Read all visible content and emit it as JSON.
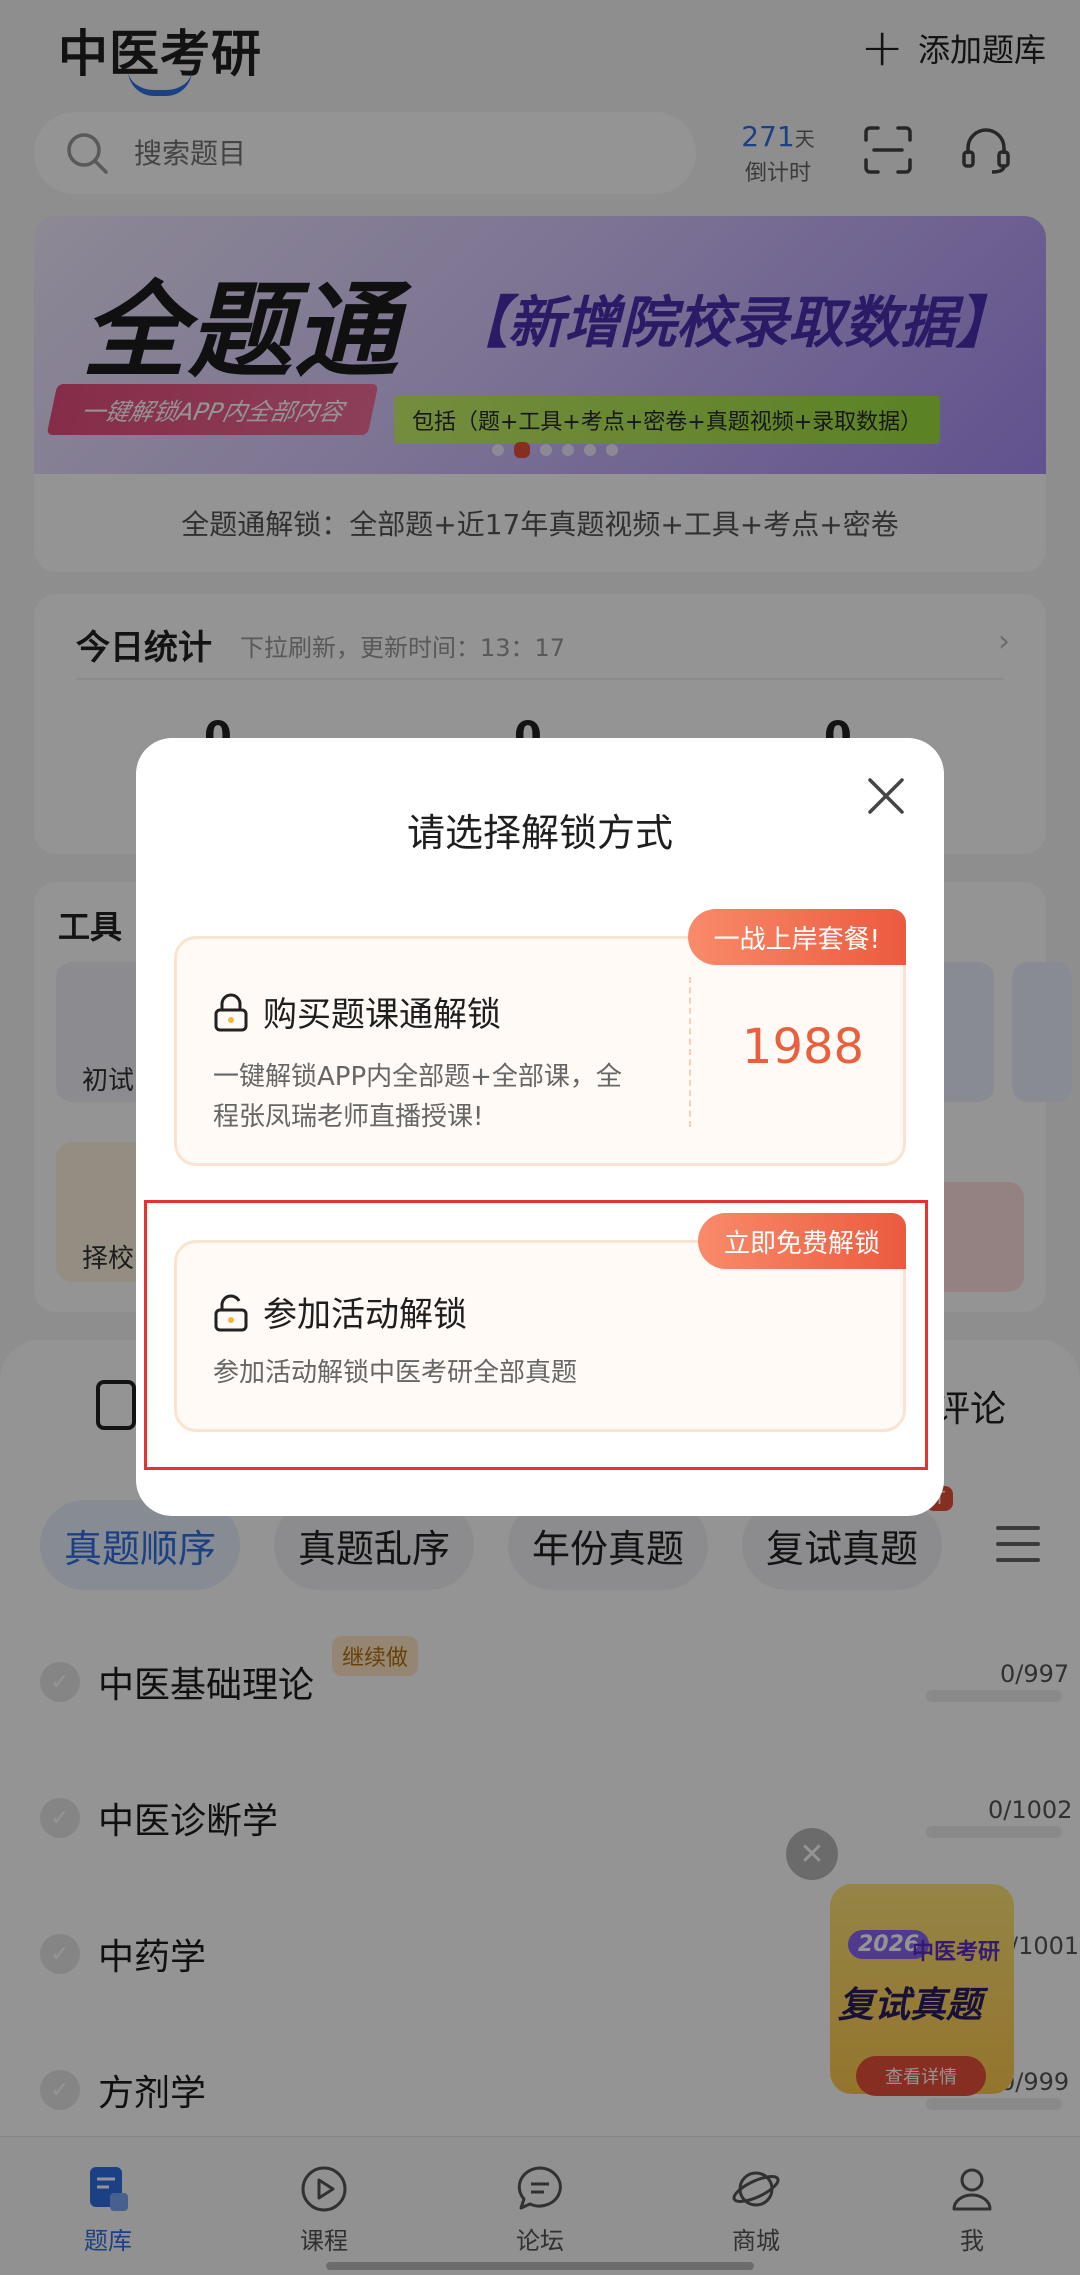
{
  "header": {
    "app_title": "中医考研",
    "add_bank_label": "添加题库",
    "search_placeholder": "搜索题目",
    "countdown_num": "271",
    "countdown_unit": "天",
    "countdown_label": "倒计时"
  },
  "banner": {
    "title": "全题通",
    "subtitle": "【新增院校录取数据】",
    "tag": "一键解锁APP内全部内容",
    "desc": "包括（题+工具+考点+密卷+真题视频+录取数据）",
    "unlock_strip": "全题通解锁：全部题+近17年真题视频+工具+考点+密卷"
  },
  "stats": {
    "title": "今日统计",
    "subtitle": "下拉刷新，更新时间：13：17",
    "values": [
      "0",
      "0",
      "0"
    ]
  },
  "tools": {
    "title": "工具",
    "items": [
      "初试",
      "择校"
    ]
  },
  "lower": {
    "comment_label": "评论",
    "tabs": [
      "真题顺序",
      "真题乱序",
      "年份真题",
      "复试真题"
    ],
    "hot_tag": "T",
    "continue_tag": "继续做",
    "subjects": [
      {
        "name": "中医基础理论",
        "count": "0/997"
      },
      {
        "name": "中医诊断学",
        "count": "0/1002"
      },
      {
        "name": "中药学",
        "count": "/1001"
      },
      {
        "name": "方剂学",
        "count": "0/999"
      }
    ]
  },
  "promo": {
    "year": "2026",
    "brand": "中医考研",
    "title": "复试真题",
    "button": "查看详情"
  },
  "nav": [
    {
      "label": "题库",
      "icon": "question-bank-icon"
    },
    {
      "label": "课程",
      "icon": "play-icon"
    },
    {
      "label": "论坛",
      "icon": "chat-icon"
    },
    {
      "label": "商城",
      "icon": "planet-icon"
    },
    {
      "label": "我",
      "icon": "user-icon"
    }
  ],
  "modal": {
    "title": "请选择解锁方式",
    "options": [
      {
        "badge": "一战上岸套餐!",
        "title": "购买题课通解锁",
        "desc_line1": "一键解锁APP内全部题+全部课，全",
        "desc_line2": "程张凤瑞老师直播授课!",
        "price": "1988"
      },
      {
        "badge": "立即免费解锁",
        "title": "参加活动解锁",
        "desc_line1": "参加活动解锁中医考研全部真题"
      }
    ]
  },
  "colors": {
    "accent": "#2f6fe4",
    "modal_accent": "#e8603d",
    "highlight": "#e8322c"
  }
}
